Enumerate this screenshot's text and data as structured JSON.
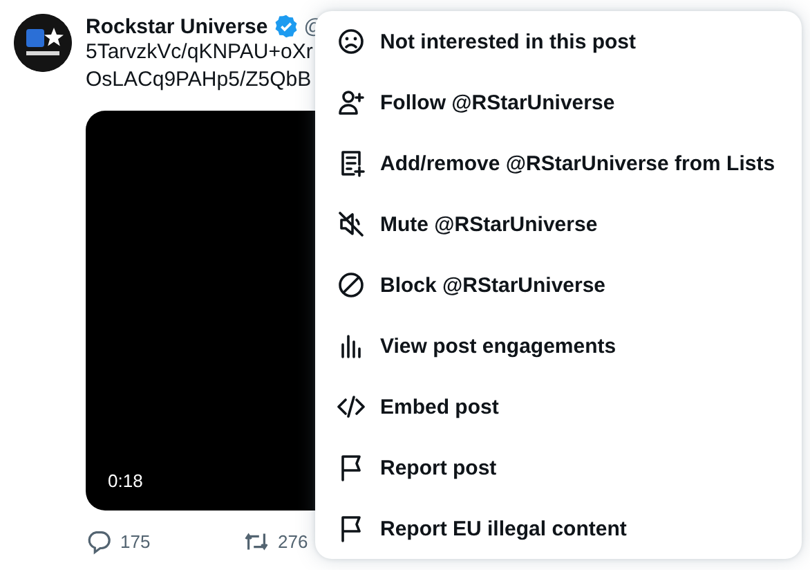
{
  "post": {
    "author": "Rockstar Universe",
    "verified": true,
    "handle": "@",
    "text_lines": [
      "5TarvzkVc/qKNPAU+oXr",
      "OsLACq9PAHp5/Z5QbB"
    ],
    "video": {
      "duration": "0:18"
    },
    "actions": [
      {
        "kind": "reply",
        "count": "175"
      },
      {
        "kind": "repost",
        "count": "276"
      }
    ]
  },
  "menu": {
    "items": [
      {
        "kind": "sad",
        "label": "Not interested in this post"
      },
      {
        "kind": "follow",
        "label": "Follow @RStarUniverse"
      },
      {
        "kind": "list",
        "label": "Add/remove @RStarUniverse from Lists"
      },
      {
        "kind": "mute",
        "label": "Mute @RStarUniverse"
      },
      {
        "kind": "block",
        "label": "Block @RStarUniverse"
      },
      {
        "kind": "stats",
        "label": "View post engagements"
      },
      {
        "kind": "embed",
        "label": "Embed post"
      },
      {
        "kind": "flag",
        "label": "Report post"
      },
      {
        "kind": "flag",
        "label": "Report EU illegal content"
      }
    ]
  }
}
